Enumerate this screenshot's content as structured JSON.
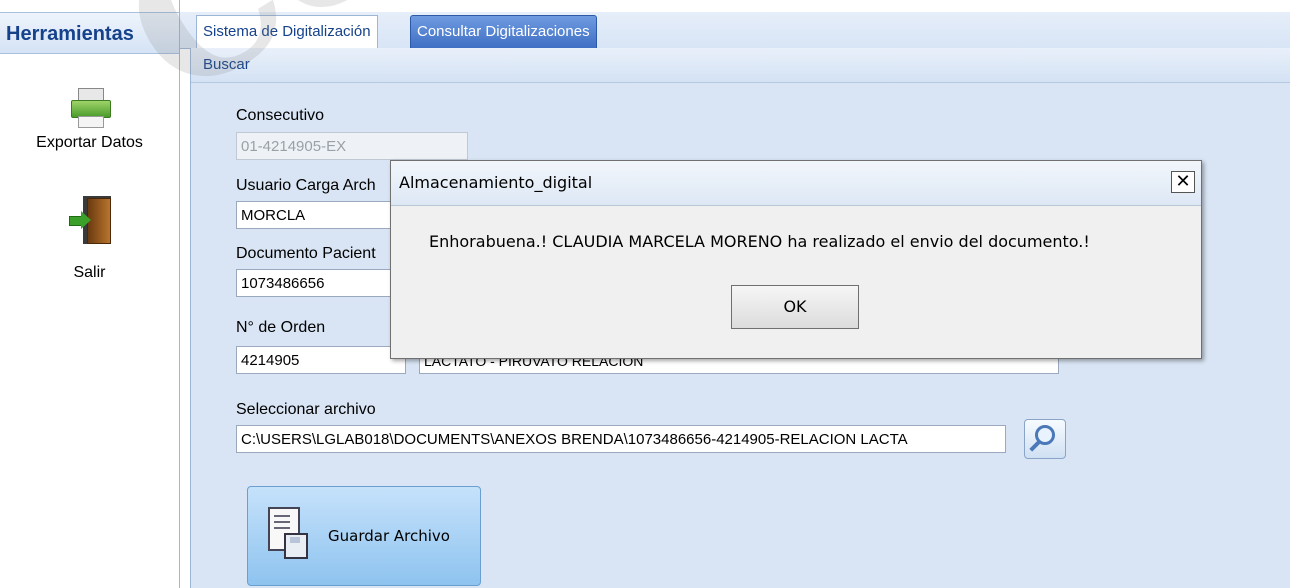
{
  "tools": {
    "title": "Herramientas",
    "items": [
      {
        "label": "Exportar Datos",
        "icon": "printer-icon"
      },
      {
        "label": "Salir",
        "icon": "exit-door-icon"
      }
    ]
  },
  "tabs": [
    {
      "label": "Sistema de Digitalización"
    },
    {
      "label": "Consultar Digitalizaciones"
    }
  ],
  "toolbar": {
    "buscar_label": "Buscar"
  },
  "form": {
    "consecutivo_label": "Consecutivo",
    "consecutivo_value": "01-4214905-EX",
    "usuario_label": "Usuario Carga Arch",
    "usuario_value": "MORCLA",
    "documento_label": "Documento Pacient",
    "documento_value": "1073486656",
    "orden_label": "N° de Orden",
    "orden_value": "4214905",
    "examen_value": "LACTATO - PIRUVATO RELACION",
    "archivo_label": "Seleccionar archivo",
    "archivo_value": "C:\\USERS\\LGLAB018\\DOCUMENTS\\ANEXOS BRENDA\\1073486656-4214905-RELACION LACTA",
    "save_label": "Guardar Archivo"
  },
  "dialog": {
    "title": "Almacenamiento_digital",
    "close_label": "✕",
    "message": "Enhorabuena.! CLAUDIA MARCELA MORENO ha realizado el envio del documento.!",
    "ok_label": "OK"
  },
  "watermark": "Copia"
}
